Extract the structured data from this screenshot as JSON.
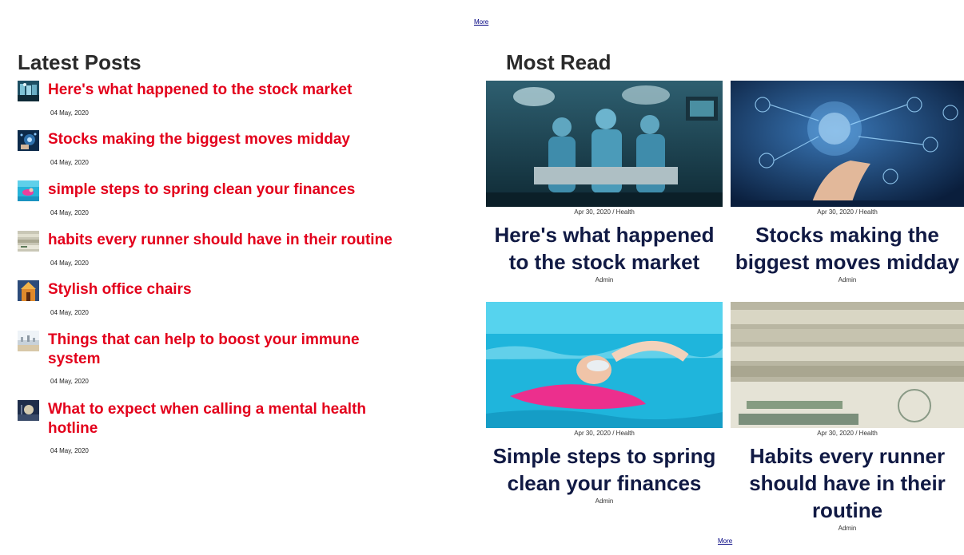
{
  "top_more": "More",
  "latest": {
    "heading": "Latest Posts",
    "items": [
      {
        "title": "Here's what happened to the stock market",
        "date": "04 May, 2020",
        "thumb": "surgery-thumb"
      },
      {
        "title": "Stocks making the biggest moves midday",
        "date": "04 May, 2020",
        "thumb": "tech-thumb"
      },
      {
        "title": "simple steps to spring clean your finances",
        "date": "04 May, 2020",
        "thumb": "swim-thumb"
      },
      {
        "title": "habits every runner should have in their routine",
        "date": "04 May, 2020",
        "thumb": "money-thumb"
      },
      {
        "title": "Stylish office chairs",
        "date": "04 May, 2020",
        "thumb": "temple-thumb"
      },
      {
        "title": "Things that can help to boost your immune system",
        "date": "04 May, 2020",
        "thumb": "city-thumb"
      },
      {
        "title": "What to expect when calling a mental health hotline",
        "date": "04 May, 2020",
        "thumb": "night-thumb"
      }
    ]
  },
  "most_read": {
    "heading": "Most Read",
    "cards": [
      {
        "meta": "Apr 30, 2020 / Health",
        "title": "Here's what happened to the stock market",
        "author": "Admin"
      },
      {
        "meta": "Apr 30, 2020 / Health",
        "title": "Stocks making the biggest moves midday",
        "author": "Admin"
      },
      {
        "meta": "Apr 30, 2020 / Health",
        "title": "Simple steps to spring clean your finances",
        "author": "Admin"
      },
      {
        "meta": "Apr 30, 2020 / Health",
        "title": "Habits every runner should have in their routine",
        "author": "Admin"
      }
    ],
    "more": "More"
  }
}
